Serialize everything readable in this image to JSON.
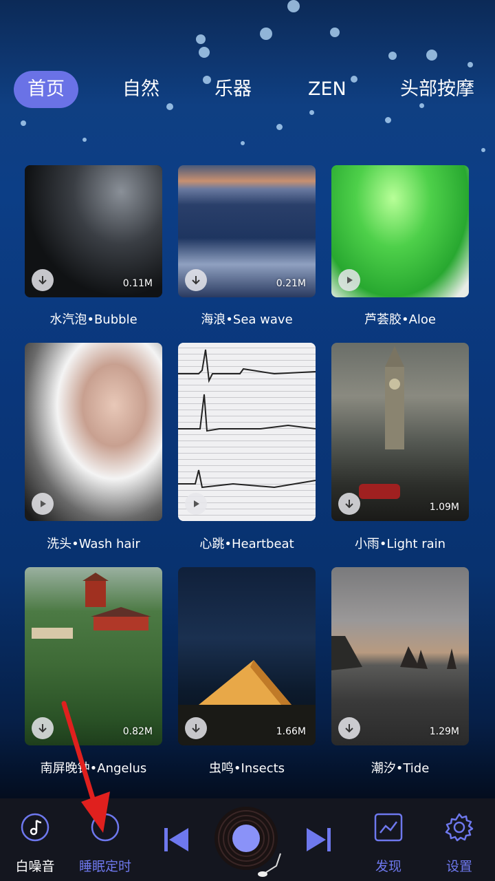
{
  "tabs": [
    {
      "label": "首页",
      "active": true
    },
    {
      "label": "自然",
      "active": false
    },
    {
      "label": "乐器",
      "active": false
    },
    {
      "label": "ZEN",
      "active": false
    },
    {
      "label": "头部按摩",
      "active": false
    }
  ],
  "sounds": [
    {
      "label": "水汽泡•Bubble",
      "size": "0.11M",
      "button": "download-icon"
    },
    {
      "label": "海浪•Sea wave",
      "size": "0.21M",
      "button": "download-icon"
    },
    {
      "label": "芦荟胶•Aloe",
      "size": "",
      "button": "play-icon"
    },
    {
      "label": "洗头•Wash hair",
      "size": "",
      "button": "play-icon"
    },
    {
      "label": "心跳•Heartbeat",
      "size": "",
      "button": "play-icon"
    },
    {
      "label": "小雨•Light rain",
      "size": "1.09M",
      "button": "download-icon"
    },
    {
      "label": "南屏晚钟•Angelus",
      "size": "0.82M",
      "button": "download-icon"
    },
    {
      "label": "虫鸣•Insects",
      "size": "1.66M",
      "button": "download-icon"
    },
    {
      "label": "潮汐•Tide",
      "size": "1.29M",
      "button": "download-icon"
    }
  ],
  "bottom_nav": {
    "white_noise": "白噪音",
    "sleep_timer": "睡眠定时",
    "discover": "发现",
    "settings": "设置"
  },
  "colors": {
    "accent": "#6a72e6",
    "bar_background": "#14161f",
    "annotation_arrow": "#e0201e"
  }
}
